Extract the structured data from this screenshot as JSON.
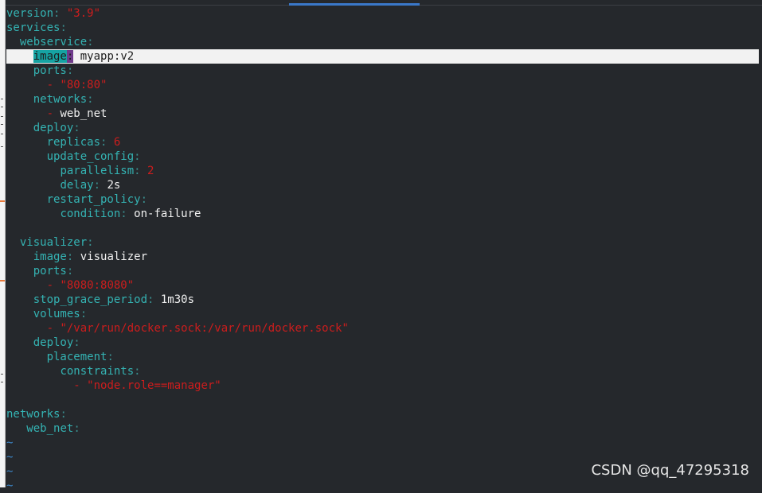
{
  "editor": {
    "lines": [
      {
        "indent": "",
        "key": "version",
        "sep": ": ",
        "value": "\"3.9\"",
        "vtype": "str"
      },
      {
        "indent": "",
        "key": "services",
        "sep": ":",
        "value": "",
        "vtype": ""
      },
      {
        "indent": "  ",
        "key": "webservice",
        "sep": ":",
        "value": "",
        "vtype": ""
      },
      {
        "indent": "    ",
        "key": "image",
        "sep": ":",
        "value": " myapp:v2",
        "vtype": "val",
        "cursor": true
      },
      {
        "indent": "    ",
        "key": "ports",
        "sep": ":",
        "value": "",
        "vtype": ""
      },
      {
        "indent": "      ",
        "dash": "- ",
        "value": "\"80:80\"",
        "vtype": "str"
      },
      {
        "indent": "    ",
        "key": "networks",
        "sep": ":",
        "value": "",
        "vtype": ""
      },
      {
        "indent": "      ",
        "dash": "- ",
        "value": "web_net",
        "vtype": "val"
      },
      {
        "indent": "    ",
        "key": "deploy",
        "sep": ":",
        "value": "",
        "vtype": ""
      },
      {
        "indent": "      ",
        "key": "replicas",
        "sep": ": ",
        "value": "6",
        "vtype": "num"
      },
      {
        "indent": "      ",
        "key": "update_config",
        "sep": ":",
        "value": "",
        "vtype": ""
      },
      {
        "indent": "        ",
        "key": "parallelism",
        "sep": ": ",
        "value": "2",
        "vtype": "num"
      },
      {
        "indent": "        ",
        "key": "delay",
        "sep": ": ",
        "value": "2s",
        "vtype": "val"
      },
      {
        "indent": "      ",
        "key": "restart_policy",
        "sep": ":",
        "value": "",
        "vtype": ""
      },
      {
        "indent": "        ",
        "key": "condition",
        "sep": ": ",
        "value": "on-failure",
        "vtype": "val"
      },
      {
        "indent": "",
        "key": "",
        "sep": "",
        "value": "",
        "vtype": ""
      },
      {
        "indent": "  ",
        "key": "visualizer",
        "sep": ":",
        "value": "",
        "vtype": ""
      },
      {
        "indent": "    ",
        "key": "image",
        "sep": ": ",
        "value": "visualizer",
        "vtype": "val"
      },
      {
        "indent": "    ",
        "key": "ports",
        "sep": ":",
        "value": "",
        "vtype": ""
      },
      {
        "indent": "      ",
        "dash": "- ",
        "value": "\"8080:8080\"",
        "vtype": "str"
      },
      {
        "indent": "    ",
        "key": "stop_grace_period",
        "sep": ": ",
        "value": "1m30s",
        "vtype": "val"
      },
      {
        "indent": "    ",
        "key": "volumes",
        "sep": ":",
        "value": "",
        "vtype": ""
      },
      {
        "indent": "      ",
        "dash": "- ",
        "value": "\"/var/run/docker.sock:/var/run/docker.sock\"",
        "vtype": "str"
      },
      {
        "indent": "    ",
        "key": "deploy",
        "sep": ":",
        "value": "",
        "vtype": ""
      },
      {
        "indent": "      ",
        "key": "placement",
        "sep": ":",
        "value": "",
        "vtype": ""
      },
      {
        "indent": "        ",
        "key": "constraints",
        "sep": ":",
        "value": "",
        "vtype": ""
      },
      {
        "indent": "          ",
        "dash": "- ",
        "value": "\"node.role==manager\"",
        "vtype": "str"
      },
      {
        "indent": "",
        "key": "",
        "sep": "",
        "value": "",
        "vtype": ""
      },
      {
        "indent": "",
        "key": "networks",
        "sep": ":",
        "value": "",
        "vtype": ""
      },
      {
        "indent": "   ",
        "key": "web_net",
        "sep": ":",
        "value": "",
        "vtype": ""
      },
      {
        "indent": "",
        "tilde": "~"
      },
      {
        "indent": "",
        "tilde": "~"
      },
      {
        "indent": "",
        "tilde": "~"
      },
      {
        "indent": "",
        "tilde": "~"
      }
    ]
  },
  "watermark": "CSDN @qq_47295318",
  "colors": {
    "background": "#25282c",
    "key": "#34b3b3",
    "string": "#cc1d1d",
    "value": "#f0f0f0",
    "tilde": "#3c86c8",
    "cursorline": "#f2f2f2"
  }
}
